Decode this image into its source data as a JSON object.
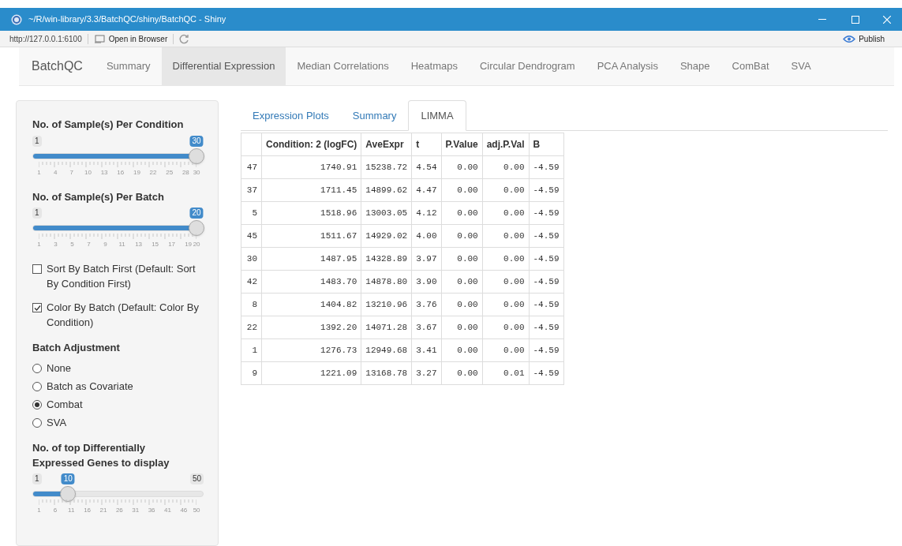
{
  "window": {
    "title": "~/R/win-library/3.3/BatchQC/shiny/BatchQC - Shiny"
  },
  "toolbar": {
    "url": "http://127.0.0.1:6100",
    "open_in_browser": "Open in Browser",
    "publish": "Publish"
  },
  "navbar": {
    "brand": "BatchQC",
    "tabs": [
      {
        "label": "Summary",
        "selected": false
      },
      {
        "label": "Differential Expression",
        "selected": true
      },
      {
        "label": "Median Correlations",
        "selected": false
      },
      {
        "label": "Heatmaps",
        "selected": false
      },
      {
        "label": "Circular Dendrogram",
        "selected": false
      },
      {
        "label": "PCA Analysis",
        "selected": false
      },
      {
        "label": "Shape",
        "selected": false
      },
      {
        "label": "ComBat",
        "selected": false
      },
      {
        "label": "SVA",
        "selected": false
      }
    ]
  },
  "sidebar": {
    "sliders_top": [
      {
        "label": "No. of Sample(s) Per Condition",
        "min": "1",
        "value": "30",
        "level": 1,
        "ticks": [
          "1",
          "4",
          "7",
          "10",
          "13",
          "16",
          "19",
          "22",
          "25",
          "28",
          "30"
        ]
      },
      {
        "label": "No. of Sample(s) Per Batch",
        "min": "1",
        "value": "20",
        "level": 1,
        "ticks": [
          "1",
          "3",
          "5",
          "7",
          "9",
          "11",
          "13",
          "15",
          "17",
          "19",
          "20"
        ]
      }
    ],
    "checkboxes": [
      {
        "label": "Sort By Batch First (Default: Sort By Condition First)",
        "checked": false
      },
      {
        "label": "Color By Batch (Default: Color By Condition)",
        "checked": true
      }
    ],
    "batch_adjustment": {
      "label": "Batch Adjustment",
      "options": [
        {
          "label": "None",
          "selected": false
        },
        {
          "label": "Batch as Covariate",
          "selected": false
        },
        {
          "label": "Combat",
          "selected": true
        },
        {
          "label": "SVA",
          "selected": false
        }
      ]
    },
    "slider_bottom": {
      "label": "No. of top Differentially Expressed Genes to display",
      "min": "1",
      "max": "50",
      "value": "10",
      "level": 0.184,
      "ticks": [
        "1",
        "6",
        "11",
        "16",
        "21",
        "26",
        "31",
        "36",
        "41",
        "46",
        "50"
      ]
    }
  },
  "main": {
    "tabs": [
      {
        "label": "Expression Plots",
        "selected": false
      },
      {
        "label": "Summary",
        "selected": false
      },
      {
        "label": "LIMMA",
        "selected": true
      }
    ],
    "table": {
      "columns": [
        "Condition: 2 (logFC)",
        "AveExpr",
        "t",
        "P.Value",
        "adj.P.Val",
        "B"
      ],
      "rows": [
        {
          "label": "47",
          "cells": [
            "1740.91",
            "15238.72",
            "4.54",
            "0.00",
            "0.00",
            "-4.59"
          ]
        },
        {
          "label": "37",
          "cells": [
            "1711.45",
            "14899.62",
            "4.47",
            "0.00",
            "0.00",
            "-4.59"
          ]
        },
        {
          "label": "5",
          "cells": [
            "1518.96",
            "13003.05",
            "4.12",
            "0.00",
            "0.00",
            "-4.59"
          ]
        },
        {
          "label": "45",
          "cells": [
            "1511.67",
            "14929.02",
            "4.00",
            "0.00",
            "0.00",
            "-4.59"
          ]
        },
        {
          "label": "30",
          "cells": [
            "1487.95",
            "14328.89",
            "3.97",
            "0.00",
            "0.00",
            "-4.59"
          ]
        },
        {
          "label": "42",
          "cells": [
            "1483.70",
            "14878.80",
            "3.90",
            "0.00",
            "0.00",
            "-4.59"
          ]
        },
        {
          "label": "8",
          "cells": [
            "1404.82",
            "13210.96",
            "3.76",
            "0.00",
            "0.00",
            "-4.59"
          ]
        },
        {
          "label": "22",
          "cells": [
            "1392.20",
            "14071.28",
            "3.67",
            "0.00",
            "0.00",
            "-4.59"
          ]
        },
        {
          "label": "1",
          "cells": [
            "1276.73",
            "12949.68",
            "3.41",
            "0.00",
            "0.00",
            "-4.59"
          ]
        },
        {
          "label": "9",
          "cells": [
            "1221.09",
            "13168.78",
            "3.27",
            "0.00",
            "0.01",
            "-4.59"
          ]
        }
      ]
    }
  }
}
